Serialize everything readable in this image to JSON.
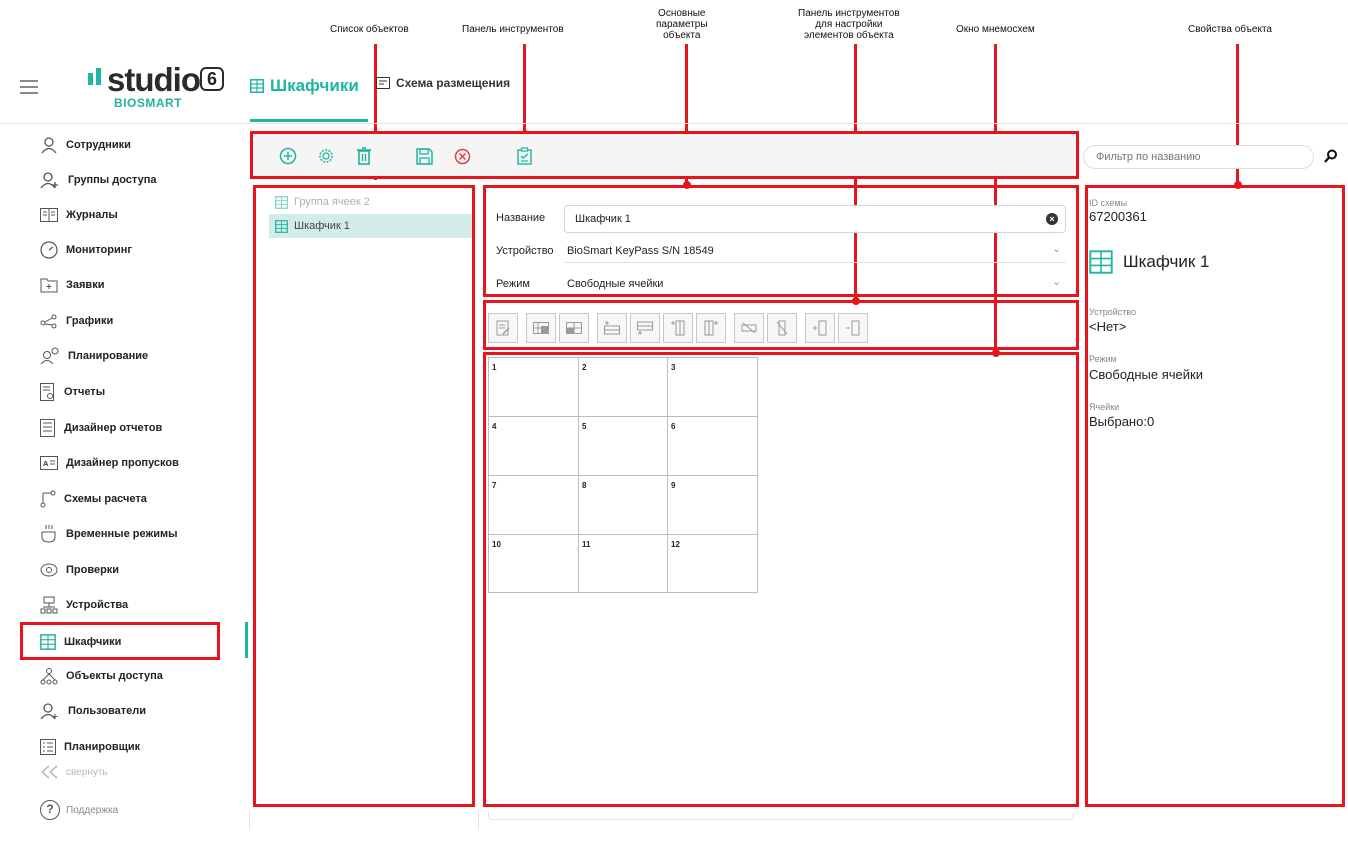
{
  "annotations": {
    "object_list": "Список объектов",
    "toolbar": "Панель инструментов",
    "main_params_line1": "Основные",
    "main_params_line2": "параметры",
    "main_params_line3": "объекта",
    "element_toolbar_line1": "Панель инструментов",
    "element_toolbar_line2": "для настройки",
    "element_toolbar_line3": "элементов объекта",
    "mnemo_window": "Окно мнемосхем",
    "object_props": "Свойства объекта"
  },
  "logo": {
    "word": "studio",
    "version": "6",
    "sub": "BIOSMART"
  },
  "tabs": [
    {
      "label": "Шкафчики",
      "icon": "locker-grid-icon",
      "active": true
    },
    {
      "label": "Схема размещения",
      "icon": "layout-scheme-icon",
      "active": false
    }
  ],
  "sidebar": {
    "items": [
      {
        "label": "Сотрудники",
        "icon": "person-icon"
      },
      {
        "label": "Группы доступа",
        "icon": "group-icon"
      },
      {
        "label": "Журналы",
        "icon": "journal-icon"
      },
      {
        "label": "Мониторинг",
        "icon": "gauge-icon"
      },
      {
        "label": "Заявки",
        "icon": "request-folder-icon"
      },
      {
        "label": "Графики",
        "icon": "schedule-graph-icon"
      },
      {
        "label": "Планирование",
        "icon": "planning-icon"
      },
      {
        "label": "Отчеты",
        "icon": "report-icon"
      },
      {
        "label": "Дизайнер отчетов",
        "icon": "report-designer-icon"
      },
      {
        "label": "Дизайнер пропусков",
        "icon": "pass-designer-icon"
      },
      {
        "label": "Схемы расчета",
        "icon": "calc-scheme-icon"
      },
      {
        "label": "Временные режимы",
        "icon": "time-mode-icon"
      },
      {
        "label": "Проверки",
        "icon": "eye-icon"
      },
      {
        "label": "Устройства",
        "icon": "devices-icon"
      },
      {
        "label": "Шкафчики",
        "icon": "locker-grid-icon",
        "active": true
      },
      {
        "label": "Объекты доступа",
        "icon": "access-objects-icon"
      },
      {
        "label": "Пользователи",
        "icon": "user-add-icon"
      },
      {
        "label": "Планировщик",
        "icon": "scheduler-list-icon"
      }
    ],
    "collapse_label": "свернуть",
    "support_label": "Поддержка"
  },
  "toolbar": {
    "buttons": [
      "add-icon",
      "settings-icon",
      "delete-icon",
      "save-icon",
      "cancel-icon",
      "checklist-icon"
    ]
  },
  "filter": {
    "placeholder": "Фильтр по названию"
  },
  "object_list": {
    "items": [
      {
        "label": "Группа ячеек 2",
        "state": "dim"
      },
      {
        "label": "Шкафчик 1",
        "state": "selected"
      }
    ]
  },
  "params": {
    "name_label": "Название",
    "name_value": "Шкафчик 1",
    "device_label": "Устройство",
    "device_value": "BioSmart KeyPass S/N 18549",
    "mode_label": "Режим",
    "mode_value": "Свободные ячейки"
  },
  "element_toolbar": {
    "groups": [
      [
        "edit-cell-icon"
      ],
      [
        "merge-cells-icon",
        "split-cells-icon"
      ],
      [
        "insert-row-above-icon",
        "insert-row-below-icon",
        "insert-col-left-icon",
        "insert-col-right-icon"
      ],
      [
        "delete-row-icon",
        "delete-col-icon"
      ],
      [
        "add-cell-icon",
        "remove-cell-icon"
      ]
    ]
  },
  "grid": {
    "cells": [
      "1",
      "2",
      "3",
      "4",
      "5",
      "6",
      "7",
      "8",
      "9",
      "10",
      "11",
      "12"
    ]
  },
  "properties": {
    "scheme_id_label": "ID схемы",
    "scheme_id_value": "67200361",
    "object_name": "Шкафчик 1",
    "device_label": "Устройство",
    "device_value": "<Нет>",
    "mode_label": "Режим",
    "mode_value": "Свободные ячейки",
    "cells_label": "Ячейки",
    "cells_value": "Выбрано:0"
  },
  "colors": {
    "accent": "#1fb5a0",
    "annotation_red": "#e8141d",
    "selected_row": "#d3ecea"
  }
}
